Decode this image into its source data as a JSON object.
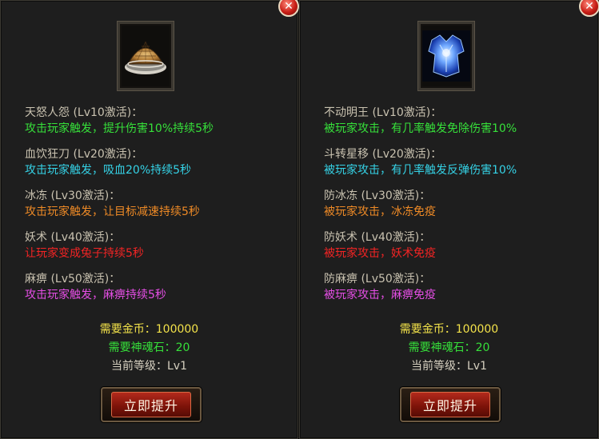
{
  "colors": {
    "skill_name": "#c9c2b0",
    "green": "#36e03a",
    "cyan": "#35d2e6",
    "orange": "#ee8a26",
    "red": "#f32424",
    "magenta": "#e64ee6",
    "gold": "#f3e24a"
  },
  "left": {
    "close_icon": "close-icon",
    "item_icon": "bamboo-hat-icon",
    "skills": [
      {
        "name": "天怒人怨 (Lv10激活)：",
        "desc": "攻击玩家触发，提升伤害10%持续5秒",
        "color": "green"
      },
      {
        "name": "血饮狂刀 (Lv20激活)：",
        "desc": "攻击玩家触发，吸血20%持续5秒",
        "color": "cyan"
      },
      {
        "name": "冰冻 (Lv30激活)：",
        "desc": "攻击玩家触发，让目标减速持续5秒",
        "color": "orange"
      },
      {
        "name": "妖术 (Lv40激活)：",
        "desc": "让玩家变成兔子持续5秒",
        "color": "red"
      },
      {
        "name": "麻痹 (Lv50激活)：",
        "desc": "攻击玩家触发，麻痹持续5秒",
        "color": "magenta"
      }
    ],
    "gold_cost": "需要金币：100000",
    "stone_cost": "需要神魂石：20",
    "current_level": "当前等级：Lv1",
    "upgrade_label": "立即提升"
  },
  "right": {
    "close_icon": "close-icon",
    "item_icon": "blue-armor-icon",
    "skills": [
      {
        "name": "不动明王 (Lv10激活)：",
        "desc": "被玩家攻击，有几率触发免除伤害10%",
        "color": "green"
      },
      {
        "name": "斗转星移 (Lv20激活)：",
        "desc": "被玩家攻击，有几率触发反弹伤害10%",
        "color": "cyan"
      },
      {
        "name": "防冰冻 (Lv30激活)：",
        "desc": "被玩家攻击，冰冻免疫",
        "color": "orange"
      },
      {
        "name": "防妖术 (Lv40激活)：",
        "desc": "被玩家攻击，妖术免疫",
        "color": "red"
      },
      {
        "name": "防麻痹 (Lv50激活)：",
        "desc": "被玩家攻击，麻痹免疫",
        "color": "magenta"
      }
    ],
    "gold_cost": "需要金币：100000",
    "stone_cost": "需要神魂石：20",
    "current_level": "当前等级：Lv1",
    "upgrade_label": "立即提升"
  }
}
